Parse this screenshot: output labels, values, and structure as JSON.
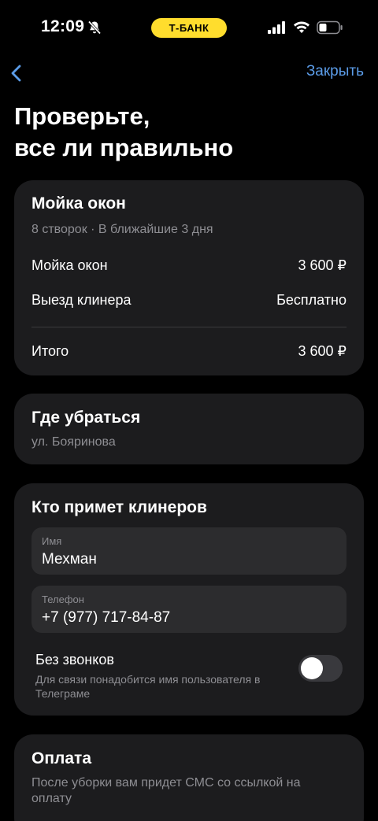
{
  "status_bar": {
    "time": "12:09",
    "bank_label": "Т-БАНК",
    "bank_color": "#ffdd2d",
    "icons": [
      "bell-off-icon",
      "signal-icon",
      "wifi-icon",
      "battery-icon"
    ]
  },
  "nav": {
    "back_icon": "chevron-left-icon",
    "close_label": "Закрыть",
    "accent_color": "#5b9ce8"
  },
  "page": {
    "title_line1": "Проверьте,",
    "title_line2": "все ли правильно"
  },
  "order": {
    "title": "Мойка окон",
    "subtitle": "8 створок · В ближайшие 3 дня",
    "rows": [
      {
        "label": "Мойка окон",
        "value": "3 600 ₽"
      },
      {
        "label": "Выезд клинера",
        "value": "Бесплатно"
      }
    ],
    "total_label": "Итого",
    "total_value": "3 600 ₽"
  },
  "address": {
    "title": "Где убраться",
    "value": "ул. Бояринова"
  },
  "receiver": {
    "title": "Кто примет клинеров",
    "name_label": "Имя",
    "name_value": "Мехман",
    "phone_label": "Телефон",
    "phone_value": "+7 (977) 717-84-87",
    "no_calls_title": "Без звонков",
    "no_calls_desc": "Для связи понадобится имя пользователя в Телеграме",
    "no_calls_enabled": false
  },
  "payment": {
    "title": "Оплата",
    "desc": "После уборки вам придет СМС со ссылкой на оплату"
  }
}
